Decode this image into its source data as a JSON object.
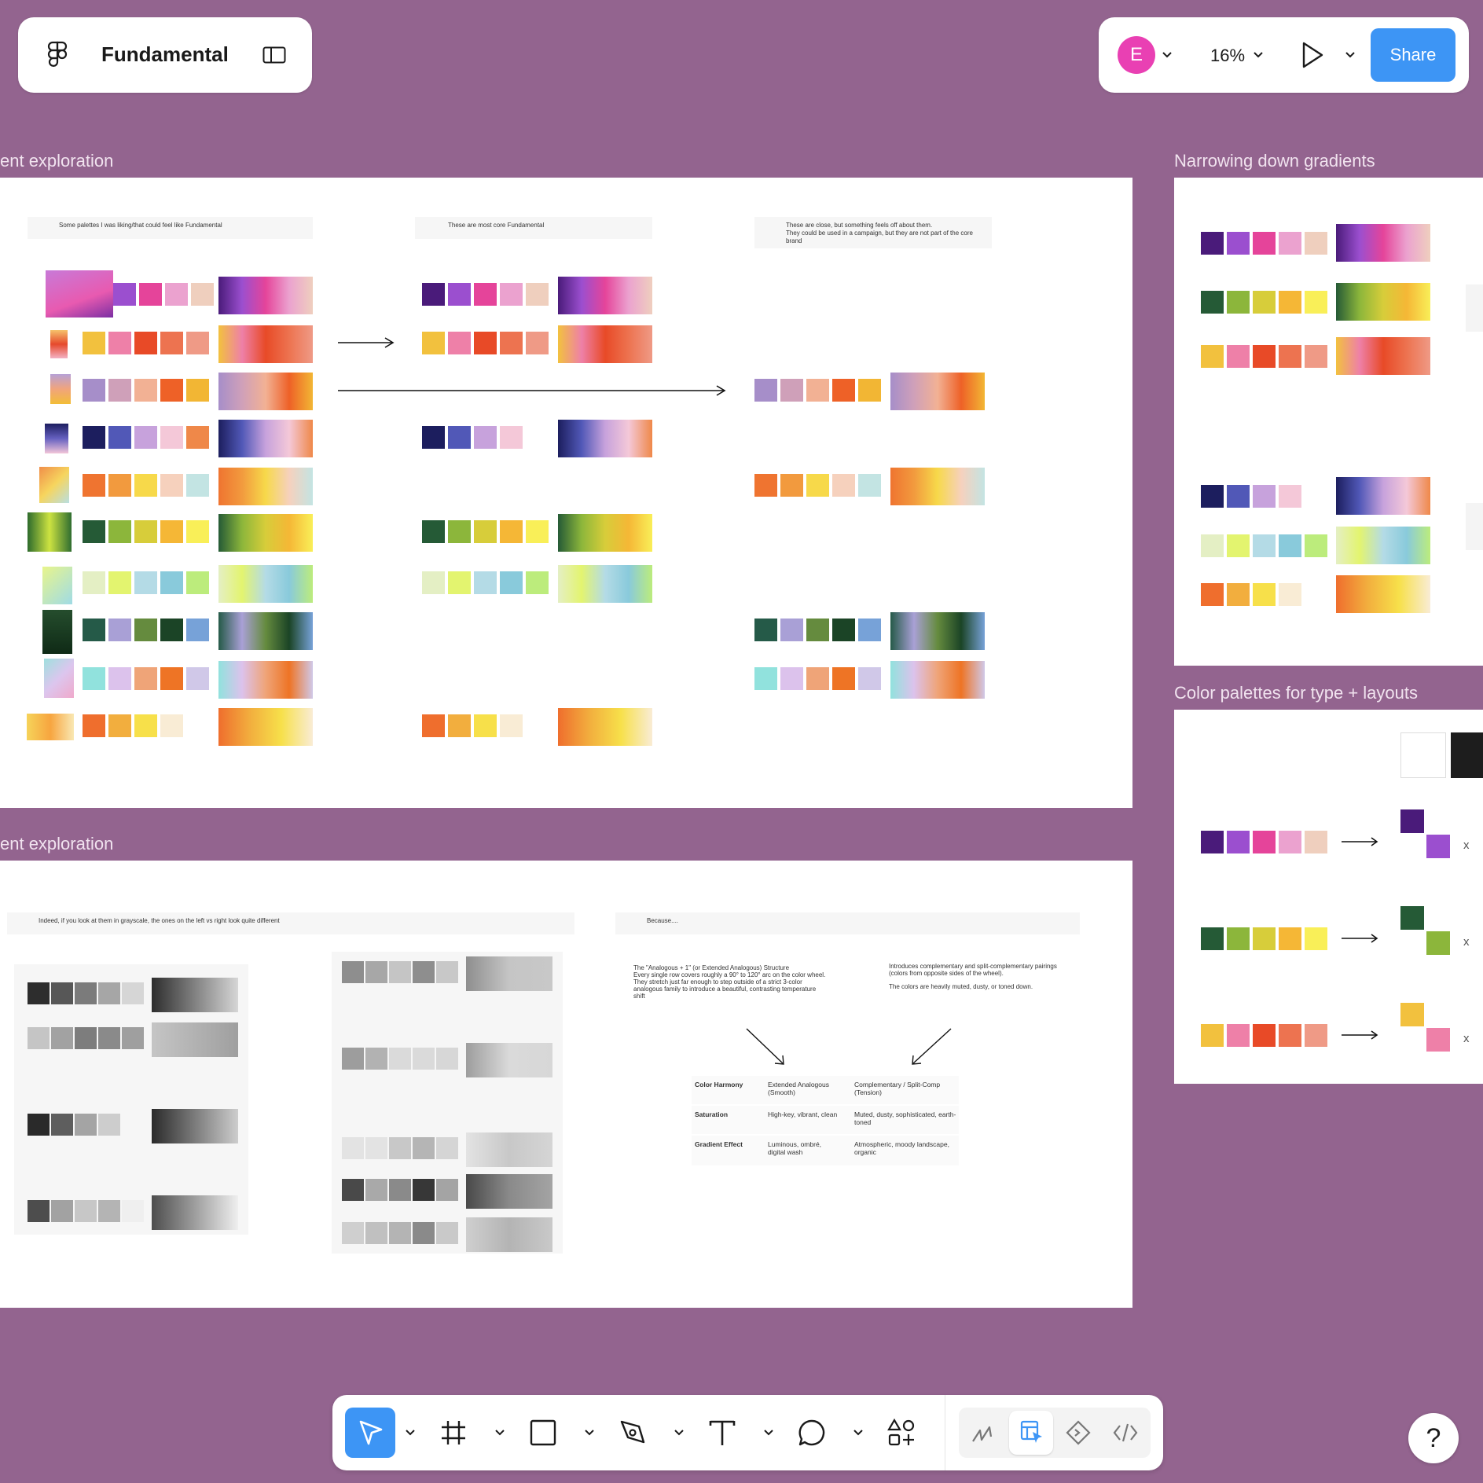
{
  "app": {
    "file_name": "Fundamental",
    "user_initial": "E",
    "zoom": "16%",
    "share_label": "Share",
    "accent": "#3d95f5",
    "avatar_color": "#e940b3"
  },
  "frames": {
    "top_left_label": "ent exploration",
    "bottom_left_label": "ent exploration",
    "narrowing_label": "Narrowing down gradients",
    "type_layouts_label": "Color palettes for type + layouts"
  },
  "notes": {
    "col1": "Some palettes I was liking/that could feel like Fundamental",
    "col2": "These are most core Fundamental",
    "col3_line1": "These are close, but something feels off about them.",
    "col3_line2": "They could be used in a campaign, but they are not part of the core brand",
    "grayscale": "Indeed, if you look at them in grayscale, the ones on the left vs right look quite different",
    "because": "Because....",
    "analogous": "The \"Analogous + 1\" (or Extended Analogous) Structure\nEvery single row covers roughly a 90° to 120° arc on the color wheel.\nThey stretch just far enough to step outside of a strict 3-color analogous family to introduce a beautiful, contrasting temperature shift",
    "complementary_1": "Introduces complementary and split-complementary pairings (colors from opposite sides of the wheel).",
    "complementary_2": "The colors are heavily muted, dusty, or toned down."
  },
  "comparison_table": {
    "rows": [
      {
        "label": "Color Harmony",
        "left": "Extended Analogous (Smooth)",
        "right": "Complementary / Split-Comp (Tension)"
      },
      {
        "label": "Saturation",
        "left": "High-key, vibrant, clean",
        "right": "Muted, dusty, sophisticated, earth-toned"
      },
      {
        "label": "Gradient Effect",
        "left": "Luminous, ombré, digital wash",
        "right": "Atmospheric, moody landscape, organic"
      }
    ]
  },
  "type_layout_marks": [
    "x",
    "x",
    "x"
  ],
  "tools": [
    "move-tool",
    "frame-tool",
    "shape-tool",
    "pen-tool",
    "text-tool",
    "comment-tool",
    "actions-tool"
  ],
  "mode_tools": [
    "draw-mode",
    "design-mode",
    "prototype-mode",
    "dev-mode"
  ],
  "help_label": "?",
  "palettes": {
    "purple": [
      "#4a1b7a",
      "#9b4fcf",
      "#e5449a",
      "#eba2cf",
      "#efcfbe"
    ],
    "warm": [
      "#f2c13e",
      "#ee80a8",
      "#e84a27",
      "#ed7350",
      "#ef9a86"
    ],
    "mauve": [
      "#a68ec9",
      "#cfa0b9",
      "#f2b194",
      "#ee6127",
      "#f2b634"
    ],
    "navy": [
      "#1c1e5e",
      "#5158b7",
      "#c7a2dc",
      "#f4c8d8",
      "#ef8849"
    ],
    "sunset": [
      "#ef7430",
      "#f29a3e",
      "#f7d94a",
      "#f6d1bd",
      "#c3e4e3"
    ],
    "green": [
      "#255a36",
      "#8cb63b",
      "#d7cd3a",
      "#f5b736",
      "#f9ef58"
    ],
    "pastel": [
      "#e4efc4",
      "#e3f46f",
      "#b4dbe6",
      "#89cadb",
      "#bcec7c"
    ],
    "forest": [
      "#255a48",
      "#a9a0d6",
      "#658b3e",
      "#1b4426",
      "#77a2d8"
    ],
    "aqua": [
      "#91e2dd",
      "#dcc2ec",
      "#efa478",
      "#ee7425",
      "#d0c8e8"
    ],
    "citrus": [
      "#ef6e2d",
      "#f2ae3e",
      "#f7e04a",
      "#f9ecd5"
    ]
  }
}
